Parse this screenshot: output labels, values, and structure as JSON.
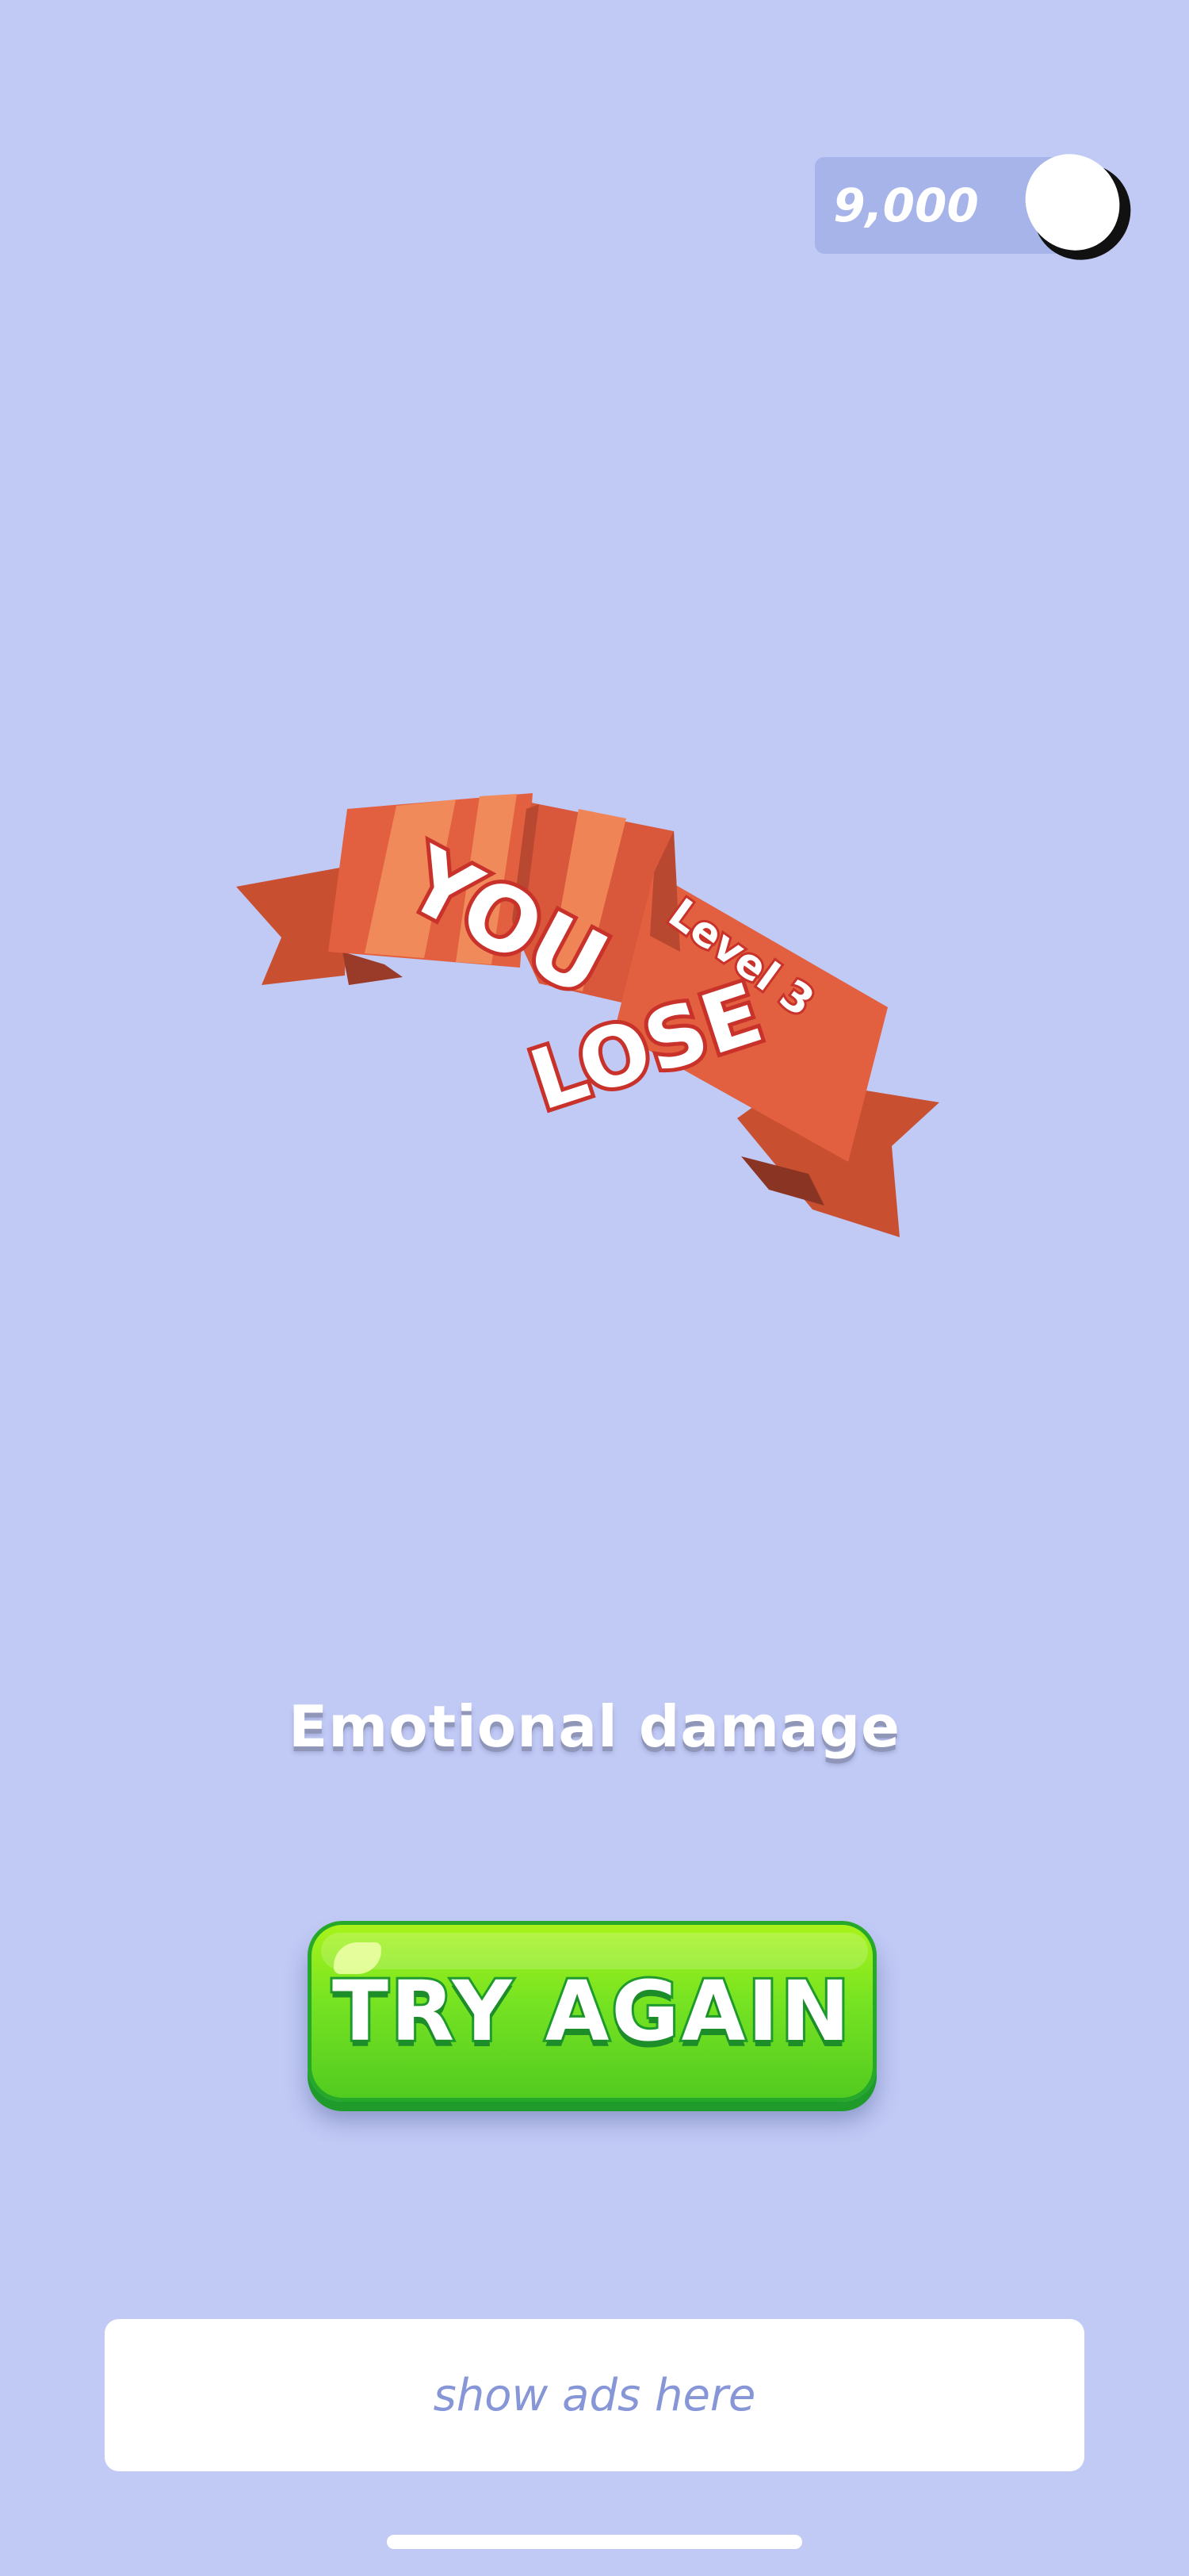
{
  "coins": {
    "amount": "9,000",
    "icon": "coin-icon"
  },
  "banner": {
    "line1": "YOU",
    "line2": "LOSE",
    "level": "Level 3"
  },
  "subtitle": "Emotional damage",
  "try_again": {
    "label": "TRY AGAIN"
  },
  "ad": {
    "text": "show ads here"
  },
  "colors": {
    "background": "#c1c9f5",
    "ribbon": "#e2603f",
    "ribbon_light": "#f08a5a",
    "ribbon_dark": "#c64e32",
    "button_green": "#6fdd1f",
    "ad_text": "#8796d6"
  }
}
